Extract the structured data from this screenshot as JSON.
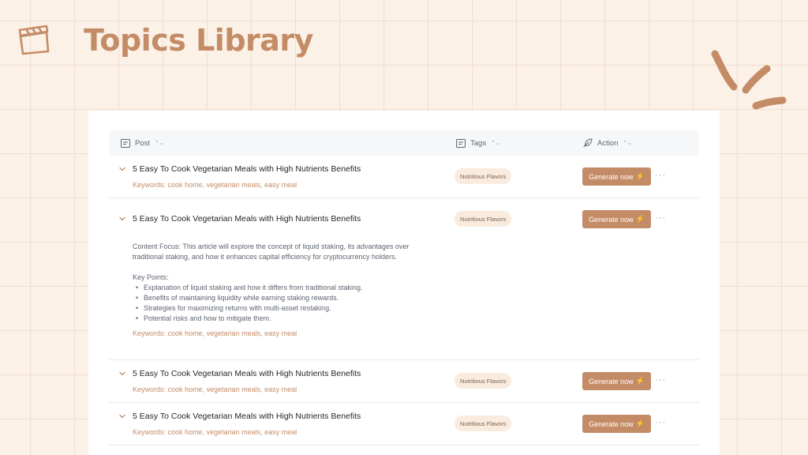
{
  "page": {
    "title": "Topics Library",
    "accent": "#c48c66",
    "background": "#fbf1e6",
    "icon": "clapperboard-icon"
  },
  "table": {
    "columns": [
      {
        "label": "Post",
        "icon": "post-icon"
      },
      {
        "label": "Tags",
        "icon": "tag-list-icon"
      },
      {
        "label": "Action",
        "icon": "feather-icon"
      }
    ],
    "sort_icon": "⌃⌄",
    "generate_label": "Generate now",
    "generate_icon": "⚡",
    "more_label": "···",
    "rows": [
      {
        "title": "5 Easy To Cook Vegetarian Meals with High Nutrients Benefits",
        "keywords": "Keywords: cook home, vegetarian meals, easy meal",
        "tag": "Nutritious Flavors",
        "expanded": false
      },
      {
        "title": "5 Easy To Cook Vegetarian Meals with High Nutrients Benefits",
        "keywords": "Keywords: cook home, vegetarian meals, easy meal",
        "tag": "Nutritious Flavors",
        "expanded": true,
        "content_focus": "Content Focus: This article will explore the concept of liquid staking, its advantages over traditional staking, and how it enhances capital efficiency for cryptocurrency holders.",
        "key_points_label": "Key Points:",
        "key_points": [
          "Explanation of liquid staking and how it differs from traditional staking.",
          "Benefits of maintaining liquidity while earning staking rewards.",
          "Strategies for maximizing returns with multi-asset restaking.",
          "Potential risks and how to mitigate them."
        ]
      },
      {
        "title": "5 Easy To Cook Vegetarian Meals with High Nutrients Benefits",
        "keywords": "Keywords: cook home, vegetarian meals, easy meal",
        "tag": "Nutritious Flavors",
        "expanded": false
      },
      {
        "title": "5 Easy To Cook Vegetarian Meals with High Nutrients Benefits",
        "keywords": "Keywords: cook home, vegetarian meals, easy meal",
        "tag": "Nutritious Flavors",
        "expanded": false
      }
    ]
  }
}
